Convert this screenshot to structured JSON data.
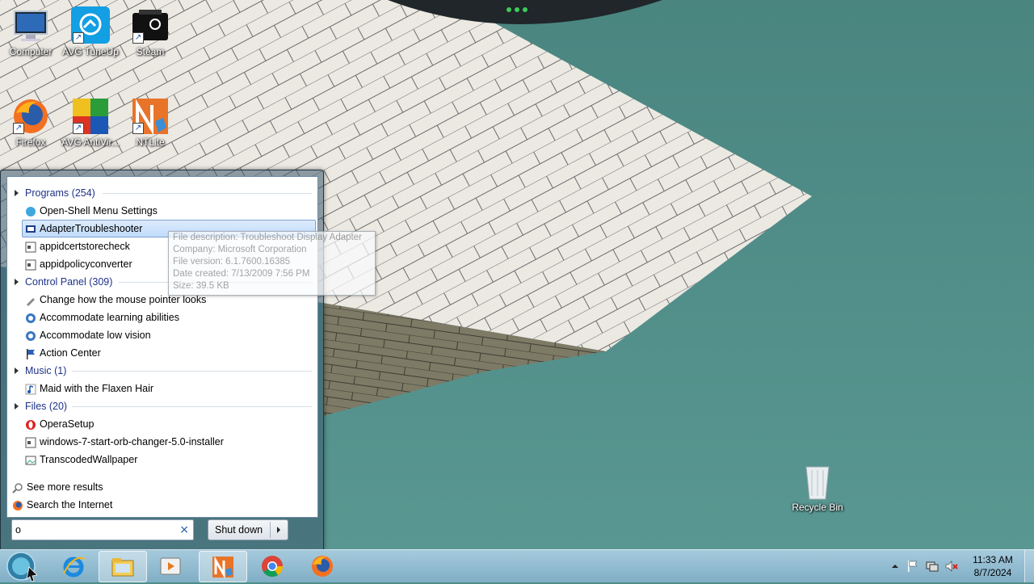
{
  "desktop": {
    "icons": [
      {
        "label": "Computer"
      },
      {
        "label": "AVG TuneUp"
      },
      {
        "label": "Steam"
      },
      {
        "label": "Firefox"
      },
      {
        "label": "AVG AntiVir..."
      },
      {
        "label": "NTLite"
      },
      {
        "label": "Recycle Bin"
      }
    ]
  },
  "start_menu": {
    "categories": {
      "programs": "Programs (254)",
      "control_panel": "Control Panel (309)",
      "music": "Music (1)",
      "files": "Files (20)"
    },
    "programs": [
      "Open-Shell Menu Settings",
      "AdapterTroubleshooter",
      "appidcertstorecheck",
      "appidpolicyconverter"
    ],
    "control_panel": [
      "Change how the mouse pointer looks",
      "Accommodate learning abilities",
      "Accommodate low vision",
      "Action Center"
    ],
    "music": [
      "Maid with the Flaxen Hair"
    ],
    "files": [
      "OperaSetup",
      "windows-7-start-orb-changer-5.0-installer",
      "TranscodedWallpaper"
    ],
    "see_more": "See more results",
    "search_internet": "Search the Internet",
    "search_value": "o",
    "clear_icon": "×",
    "shutdown_label": "Shut down"
  },
  "tooltip": {
    "description": "File description: Troubleshoot Display Adapter",
    "company": "Company: Microsoft Corporation",
    "version": "File version: 6.1.7600.16385",
    "created": "Date created: 7/13/2009 7:56 PM",
    "size": "Size: 39.5 KB"
  },
  "taskbar": {
    "time": "11:33 AM",
    "date": "8/7/2024"
  }
}
